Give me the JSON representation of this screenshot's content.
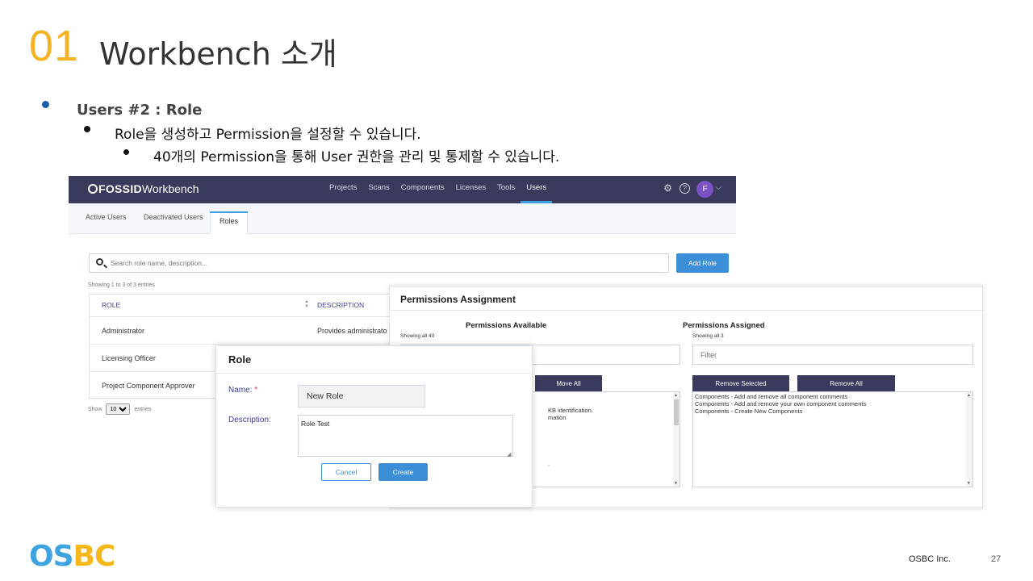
{
  "slide": {
    "number": "01",
    "title": "Workbench 소개",
    "bullets": {
      "level1": "Users #2 : Role",
      "level2": "Role을 생성하고 Permission을 설정할 수 있습니다.",
      "level3": "40개의 Permission을 통해 User 권한을 관리 및 통제할 수 있습니다."
    },
    "footer": {
      "logo_left": "OS",
      "logo_right": "BC",
      "company": "OSBC Inc.",
      "page": "27"
    },
    "colors": {
      "accent": "#f5b323",
      "bullet": "#1f5fa8",
      "logo_blue": "#3fa3e0",
      "logo_yellow": "#f6b81c"
    }
  },
  "app": {
    "logo_brand": "FOSSID",
    "logo_product": "Workbench",
    "nav": [
      "Projects",
      "Scans",
      "Components",
      "Licenses",
      "Tools",
      "Users"
    ],
    "nav_active": "Users",
    "icons": {
      "settings": "gear-icon",
      "help": "help-icon",
      "user_menu": "chevron-down-icon"
    },
    "avatar_initial": "F",
    "tabs": [
      "Active Users",
      "Deactivated Users",
      "Roles"
    ],
    "tab_active": "Roles",
    "search_placeholder": "Search role name, description...",
    "add_role": "Add Role",
    "showing": "Showing 1 to 3 of 3 entries",
    "table": {
      "headers": [
        "ROLE",
        "DESCRIPTION"
      ],
      "rows": [
        {
          "role": "Administrator",
          "description": "Provides administrato"
        },
        {
          "role": "Licensing Officer",
          "description": ""
        },
        {
          "role": "Project Component Approver",
          "description": ""
        }
      ]
    },
    "show_label": "Show",
    "show_value": "10",
    "entries_label": "entries",
    "colors": {
      "topbar": "#393a5c",
      "primary": "#3c8fd6",
      "avatar": "#7b52c4"
    }
  },
  "permissions": {
    "title": "Permissions Assignment",
    "available_title": "Permissions Available",
    "available_showing": "Showing all 40",
    "assigned_title": "Permissions Assigned",
    "assigned_showing": "Showing all 3",
    "filter_placeholder": "Filter",
    "move_all": "Move All",
    "remove_selected": "Remove Selected",
    "remove_all": "Remove All",
    "available_fragments": [
      "KB identification.",
      "mation",
      "."
    ],
    "assigned_items": [
      "Components - Add and remove all component comments",
      "Components - Add and remove your own component comments",
      "Components - Create New Components"
    ]
  },
  "role_dialog": {
    "title": "Role",
    "name_label": "Name:",
    "required_mark": "*",
    "name_value": "New Role",
    "description_label": "Description:",
    "description_value": "Role Test",
    "cancel": "Cancel",
    "create": "Create"
  }
}
